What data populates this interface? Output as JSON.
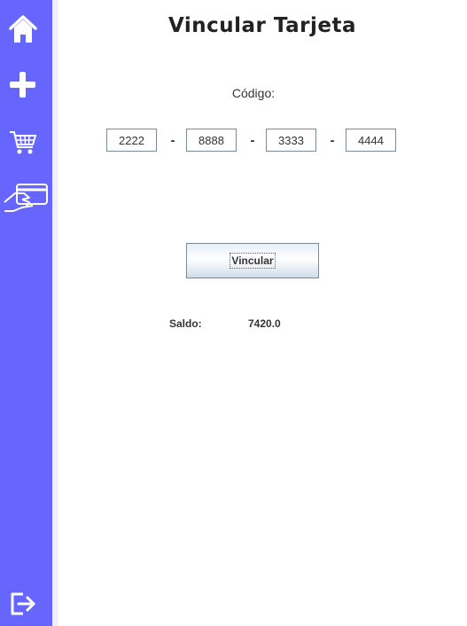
{
  "sidebar": {
    "items": [
      {
        "icon": "home-icon"
      },
      {
        "icon": "plus-icon"
      },
      {
        "icon": "cart-icon"
      },
      {
        "icon": "card-hand-icon"
      }
    ],
    "logout_icon": "logout-icon",
    "colors": {
      "background": "#6666ff",
      "icon": "#ffffff"
    }
  },
  "main": {
    "title": "Vincular Tarjeta",
    "code_label": "Código:",
    "code_fields": [
      "2222",
      "8888",
      "3333",
      "4444"
    ],
    "separator": "-",
    "link_button_label": "Vincular",
    "balance": {
      "label": "Saldo:",
      "value": "7420.0"
    }
  }
}
